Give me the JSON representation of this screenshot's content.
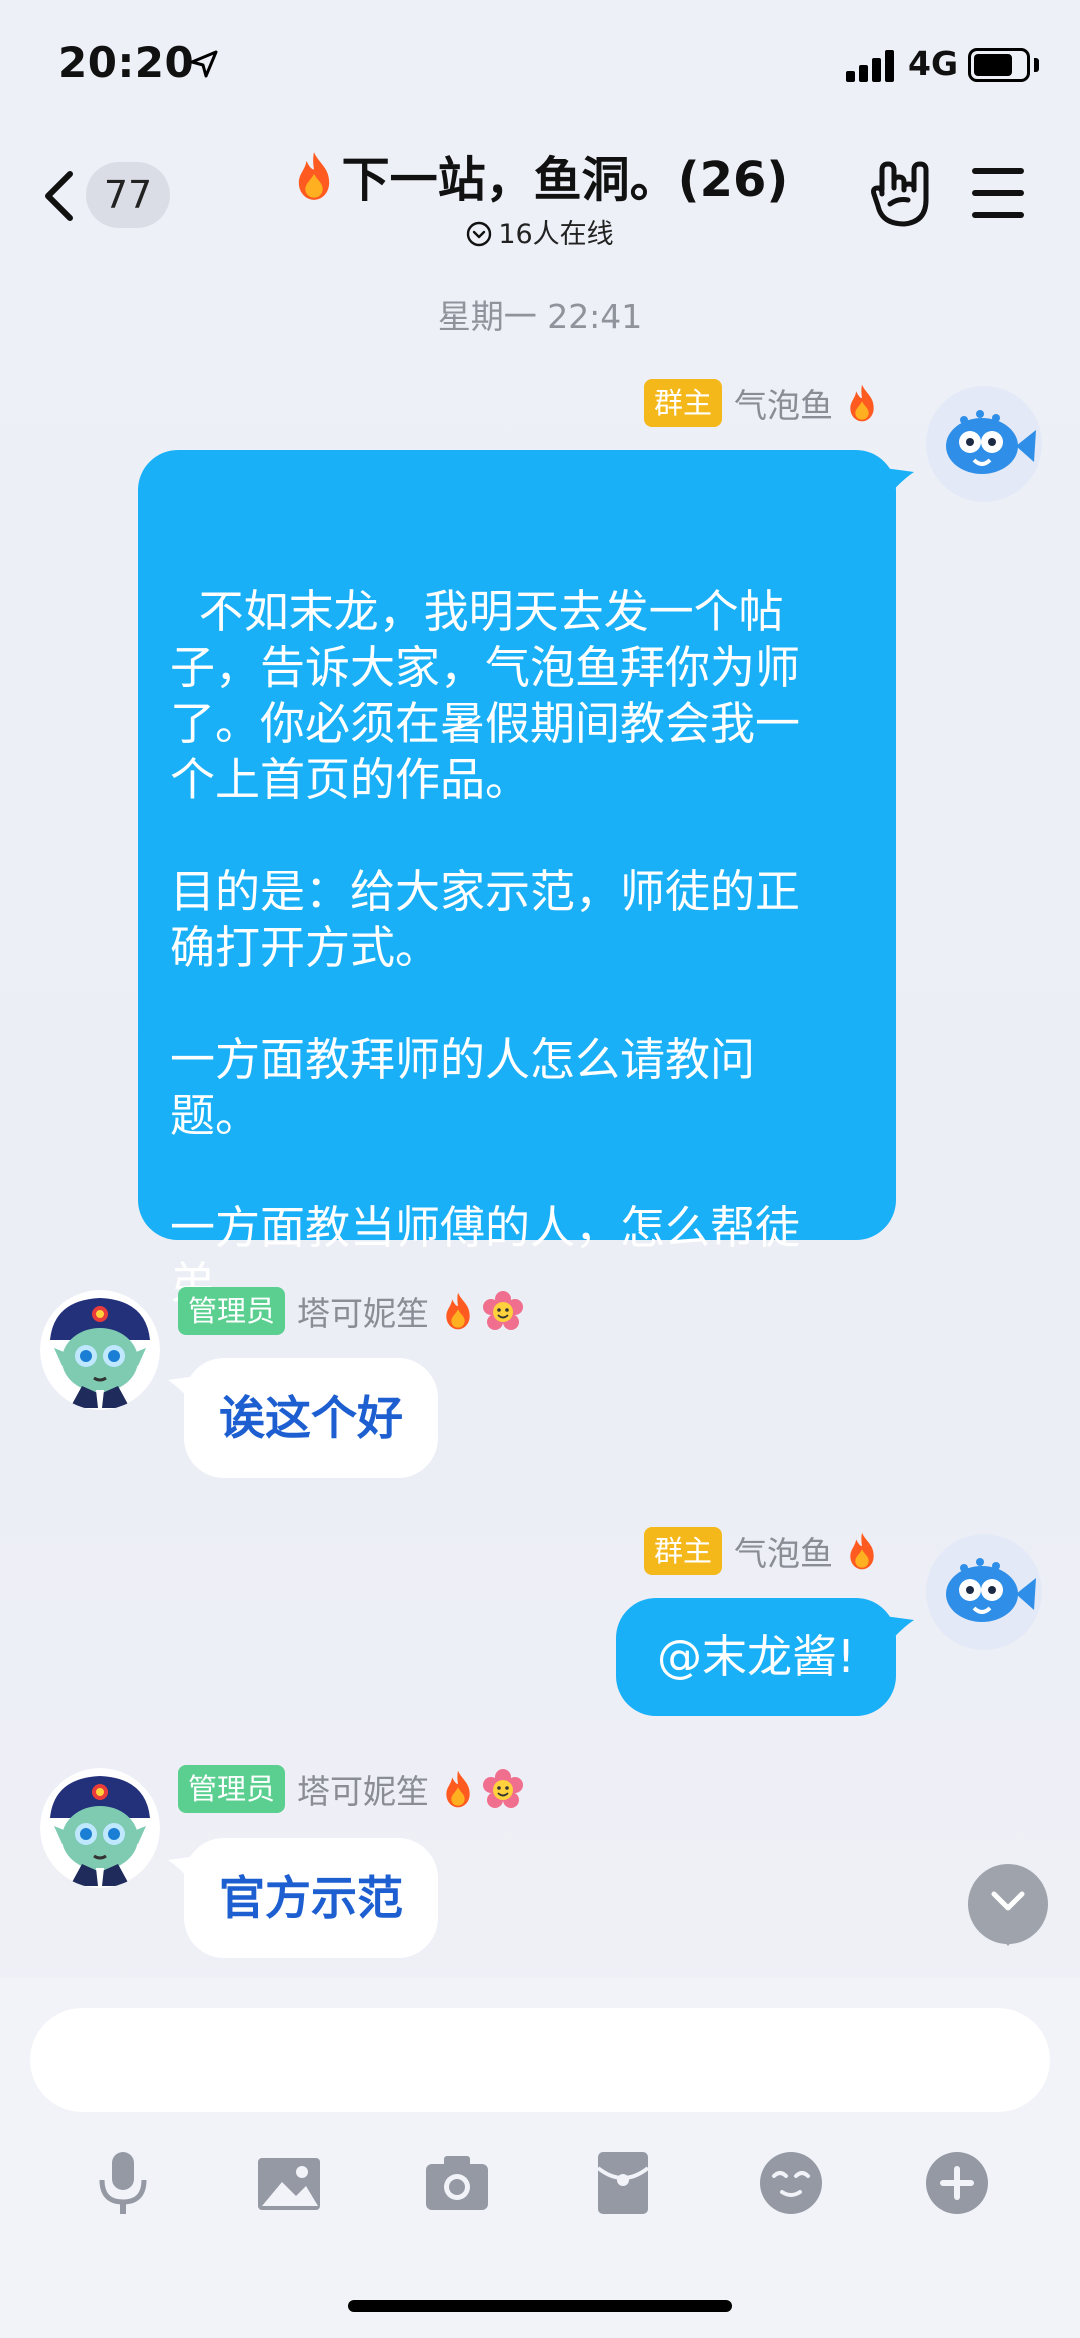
{
  "status_bar": {
    "time": "20:20",
    "network": "4G",
    "battery_level": 0.75
  },
  "nav": {
    "unread_count": "77",
    "group_title": "下一站，鱼洞。(26)",
    "online_status": "16人在线"
  },
  "chat": {
    "timestamp": "星期一 22:41",
    "messages": [
      {
        "role_badge": "群主",
        "sender": "气泡鱼",
        "text": "不如末龙，我明天去发一个帖\n子，告诉大家，气泡鱼拜你为师\n了。你必须在暑假期间教会我一\n个上首页的作品。\n\n目的是：给大家示范，师徒的正\n确打开方式。\n\n一方面教拜师的人怎么请教问\n题。\n\n一方面教当师傅的人，怎么帮徒\n弟"
      },
      {
        "role_badge": "管理员",
        "sender": "塔可妮笙",
        "text": "诶这个好"
      },
      {
        "role_badge": "群主",
        "sender": "气泡鱼",
        "text": "@末龙酱!"
      },
      {
        "role_badge": "管理员",
        "sender": "塔可妮笙",
        "text": "官方示范"
      }
    ]
  },
  "input": {
    "placeholder": "",
    "tools": [
      "mic-icon",
      "image-icon",
      "camera-icon",
      "red-packet-icon",
      "emoji-icon",
      "plus-icon"
    ]
  },
  "colors": {
    "outgoing_bubble": "#19b0f7",
    "incoming_text": "#1d5fd0",
    "owner_badge": "#f5b81a",
    "admin_badge": "#5bcf8f"
  }
}
